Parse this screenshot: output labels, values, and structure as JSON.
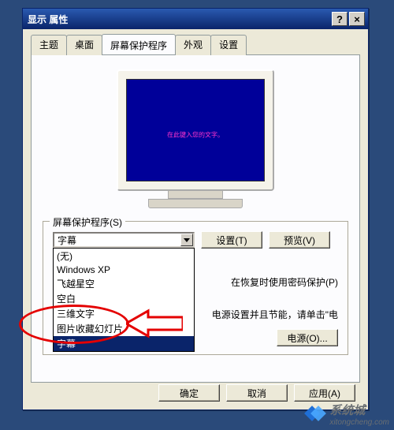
{
  "window": {
    "title": "显示 属性",
    "help_btn": "?",
    "close_btn": "×"
  },
  "tabs": [
    "主题",
    "桌面",
    "屏幕保护程序",
    "外观",
    "设置"
  ],
  "active_tab_index": 2,
  "monitor": {
    "marquee_text": "在此键入您的文字。"
  },
  "screensaver_group": {
    "label": "屏幕保护程序(S)",
    "selected": "字幕",
    "options": [
      "(无)",
      "Windows XP",
      "飞越星空",
      "空白",
      "三维文字",
      "图片收藏幻灯片",
      "字幕"
    ],
    "highlight_index": 6,
    "settings_btn": "设置(T)",
    "preview_btn": "预览(V)",
    "password_hint": "在恢复时使用密码保护(P)",
    "power_hint": "电源设置并且节能，请单击\"电",
    "power_btn": "电源(O)..."
  },
  "dialog_buttons": {
    "ok": "确定",
    "cancel": "取消",
    "apply": "应用(A)"
  },
  "watermark": {
    "text": "系统城",
    "url": "xitongcheng.com"
  }
}
